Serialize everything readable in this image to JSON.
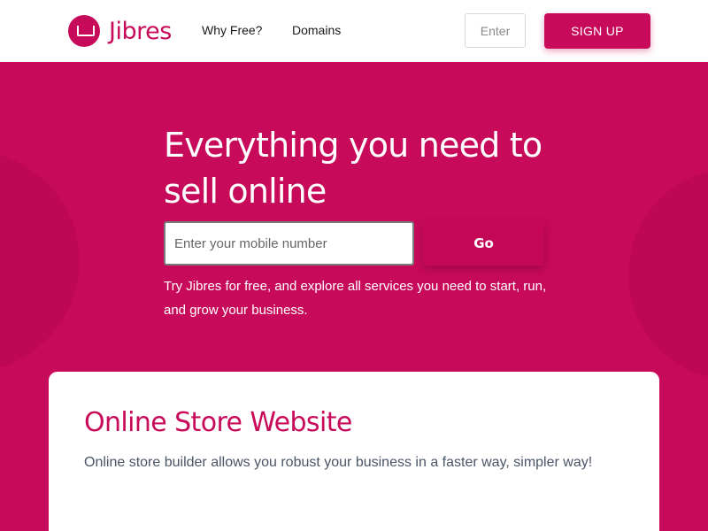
{
  "header": {
    "brand": "Jibres",
    "nav": {
      "why_free": "Why Free?",
      "domains": "Domains"
    },
    "enter_label": "Enter",
    "signup_label": "SIGN UP"
  },
  "hero": {
    "title": "Everything you need to sell online",
    "input_placeholder": "Enter your mobile number",
    "go_label": "Go",
    "description": "Try Jibres for free, and explore all services you need to start, run, and grow your business."
  },
  "card": {
    "title": "Online Store Website",
    "description": "Online store builder allows you robust your business in a faster way, simpler way!"
  },
  "colors": {
    "brand": "#c80a5a",
    "text_dark": "#1a1a1a",
    "text_muted": "#4a5568"
  }
}
